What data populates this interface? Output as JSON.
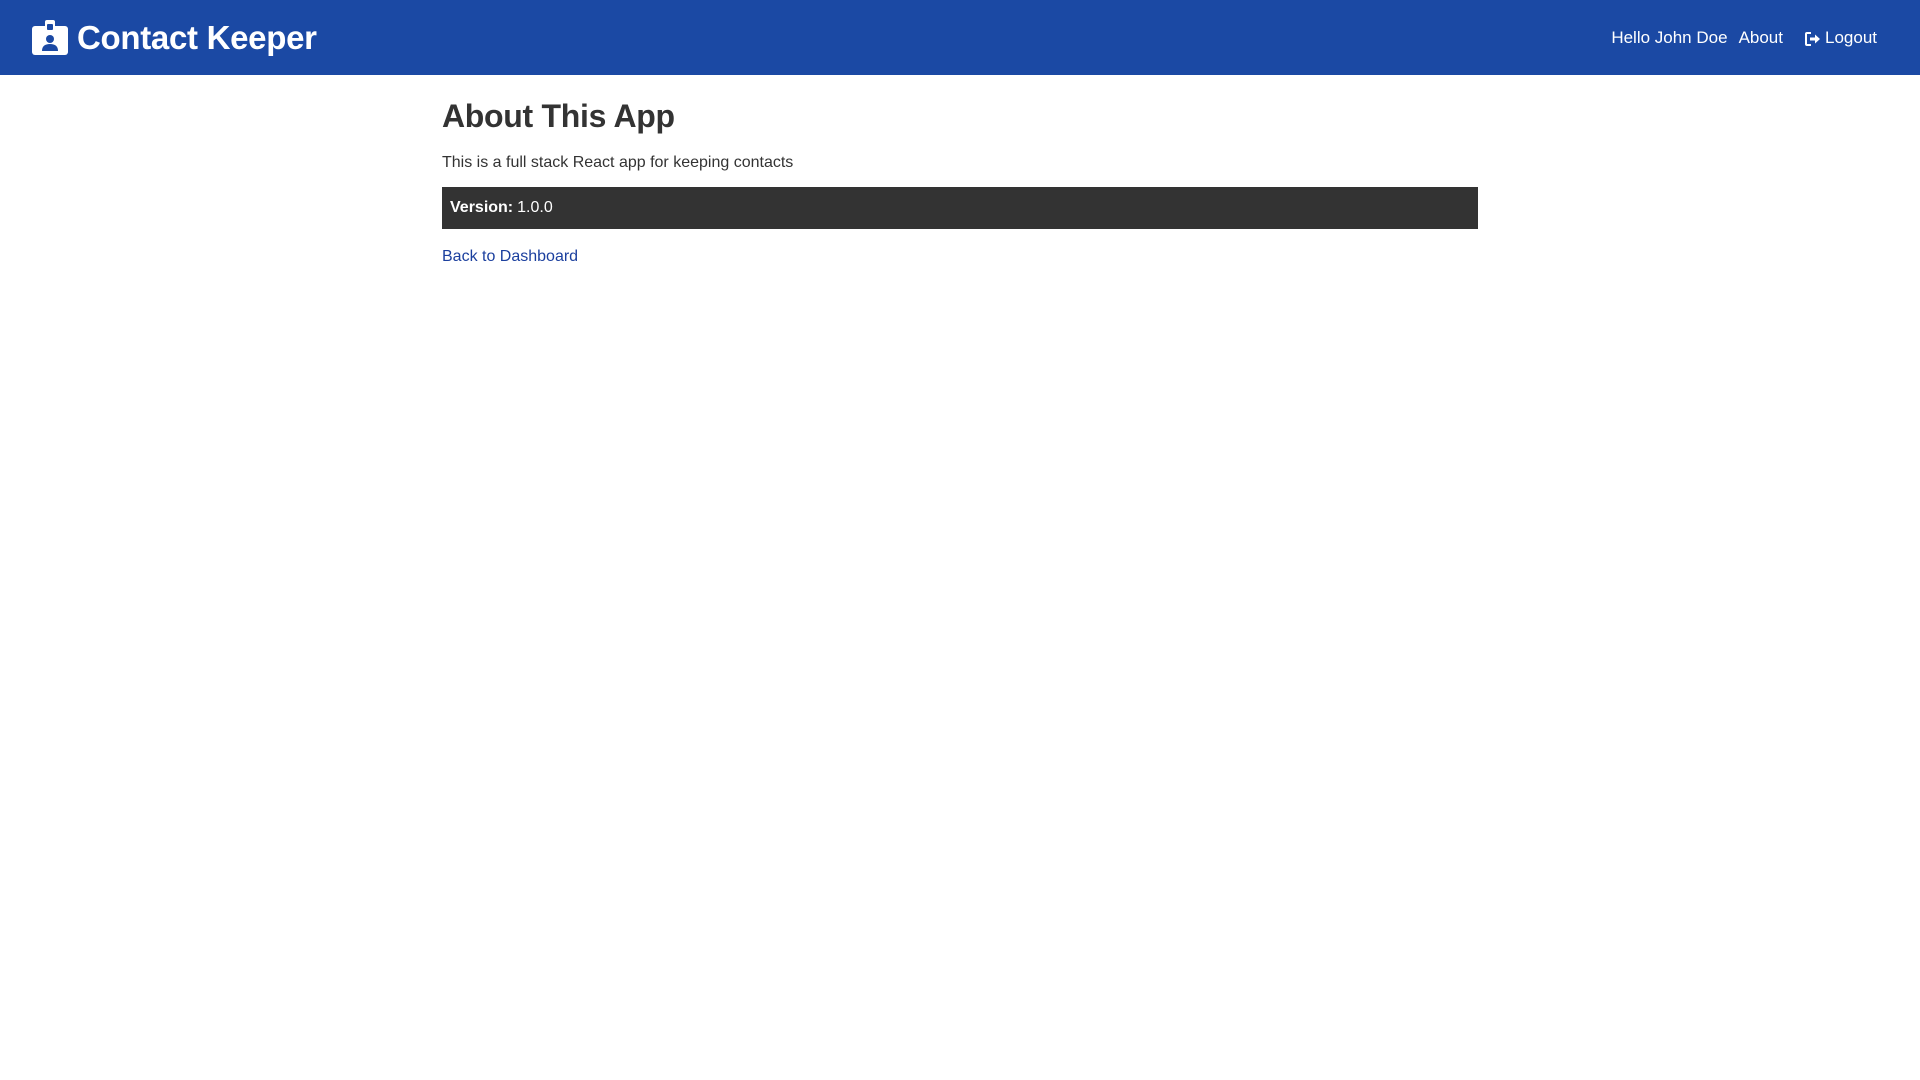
{
  "navbar": {
    "brand_title": "Contact Keeper",
    "brand_icon": "id-badge-icon",
    "greeting": "Hello John Doe",
    "about_label": "About",
    "logout_label": "Logout",
    "logout_icon": "sign-out-icon",
    "background_color": "#1b49a4"
  },
  "main": {
    "title": "About This App",
    "description": "This is a full stack React app for keeping contacts",
    "version_label": "Version:",
    "version_value": "1.0.0",
    "back_link_label": "Back to Dashboard"
  }
}
